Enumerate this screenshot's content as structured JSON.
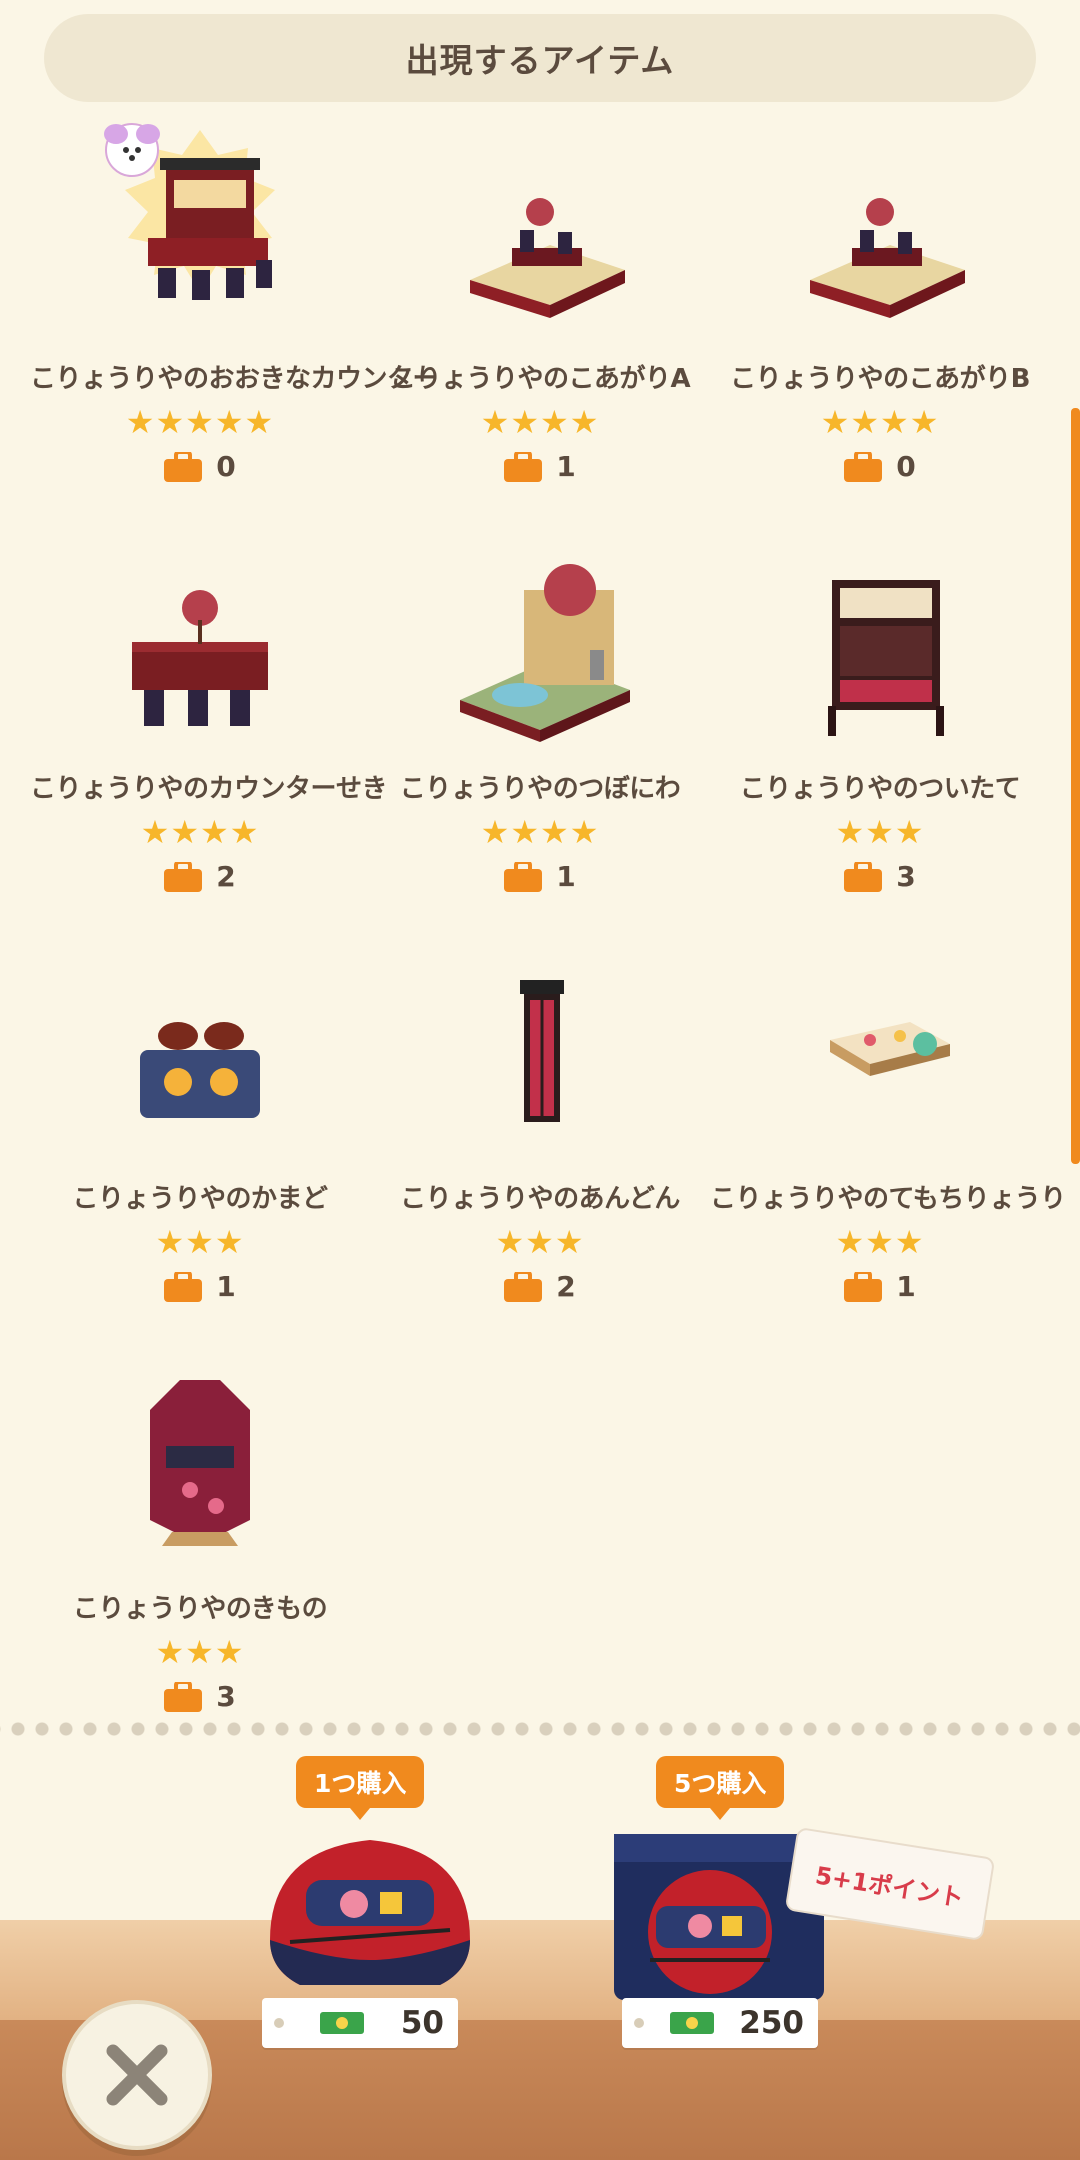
{
  "header": {
    "title": "出現するアイテム"
  },
  "items": [
    {
      "name": "こりょうりやのおおきなカウンター",
      "stars": "★★★★★",
      "count": "0",
      "icon": "big-counter-icon"
    },
    {
      "name": "こりょうりやのこあがりA",
      "stars": "★★★★",
      "count": "1",
      "icon": "raised-floor-icon"
    },
    {
      "name": "こりょうりやのこあがりB",
      "stars": "★★★★",
      "count": "0",
      "icon": "raised-floor-icon"
    },
    {
      "name": "こりょうりやのカウンターせき",
      "stars": "★★★★",
      "count": "2",
      "icon": "counter-seat-icon"
    },
    {
      "name": "こりょうりやのつぼにわ",
      "stars": "★★★★",
      "count": "1",
      "icon": "courtyard-icon"
    },
    {
      "name": "こりょうりやのついたて",
      "stars": "★★★",
      "count": "3",
      "icon": "screen-icon"
    },
    {
      "name": "こりょうりやのかまど",
      "stars": "★★★",
      "count": "1",
      "icon": "stove-icon"
    },
    {
      "name": "こりょうりやのあんどん",
      "stars": "★★★",
      "count": "2",
      "icon": "lantern-icon"
    },
    {
      "name": "こりょうりやのてもちりょうり",
      "stars": "★★★",
      "count": "1",
      "icon": "bento-icon"
    },
    {
      "name": "こりょうりやのきもの",
      "stars": "★★★",
      "count": "3",
      "icon": "kimono-icon"
    }
  ],
  "purchase": {
    "single": {
      "label": "1つ購入",
      "price": "50"
    },
    "five": {
      "label": "5つ購入",
      "price": "250",
      "bonus": "5+1ポイント"
    }
  },
  "colors": {
    "accent": "#f08a1e",
    "star": "#f7b62a",
    "background": "#fbf6e6"
  }
}
